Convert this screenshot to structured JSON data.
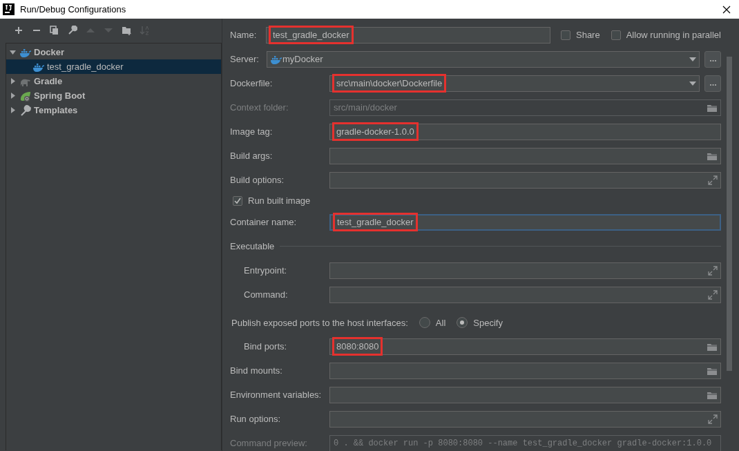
{
  "window": {
    "title": "Run/Debug Configurations"
  },
  "toolbar": [
    {
      "kind": "add",
      "disabled": false
    },
    {
      "kind": "remove",
      "disabled": false
    },
    {
      "kind": "copy",
      "disabled": false
    },
    {
      "kind": "edit",
      "disabled": false
    },
    {
      "kind": "up",
      "disabled": true
    },
    {
      "kind": "down",
      "disabled": true
    },
    {
      "kind": "folder",
      "disabled": false
    },
    {
      "kind": "sort",
      "disabled": true
    }
  ],
  "tree": [
    {
      "label": "Docker",
      "kind": "docker",
      "expanded": true,
      "selected": false,
      "children": [
        {
          "label": "test_gradle_docker",
          "kind": "docker",
          "selected": true
        }
      ]
    },
    {
      "label": "Gradle",
      "kind": "gradle",
      "expanded": false,
      "selected": false
    },
    {
      "label": "Spring Boot",
      "kind": "spring",
      "expanded": false,
      "selected": false
    },
    {
      "label": "Templates",
      "kind": "wrench",
      "expanded": false,
      "selected": false
    }
  ],
  "name": {
    "label": "Name:",
    "value": "test_gradle_docker",
    "highlighted": true
  },
  "options": [
    {
      "label": "Share",
      "checked": false
    },
    {
      "label": "Allow running in parallel",
      "checked": false
    }
  ],
  "rows": [
    {
      "kind": "combo",
      "label": "Server:",
      "value": "myDocker",
      "server_icon": true,
      "highlighted": false,
      "disabled": false
    },
    {
      "kind": "combo",
      "label": "Dockerfile:",
      "value": "src\\main\\docker\\Dockerfile",
      "highlighted": true,
      "disabled": false
    },
    {
      "kind": "browse",
      "label": "Context folder:",
      "value": "src/main/docker",
      "highlighted": false,
      "disabled": true
    },
    {
      "kind": "text",
      "label": "Image tag:",
      "value": "gradle-docker-1.0.0",
      "highlighted": true,
      "disabled": false,
      "focused": false
    },
    {
      "kind": "browse",
      "label": "Build args:",
      "disabled": false
    },
    {
      "kind": "expand",
      "label": "Build options:",
      "disabled": false
    },
    {
      "kind": "checkbox",
      "label": "Run built image",
      "checked": true
    },
    {
      "kind": "text",
      "label": "Container name:",
      "value": "test_gradle_docker",
      "highlighted": true,
      "disabled": false,
      "focused": true
    },
    {
      "kind": "section",
      "label": "Executable",
      "children": [
        {
          "kind": "expand",
          "label": "Entrypoint:",
          "disabled": false
        },
        {
          "kind": "expand",
          "label": "Command:",
          "disabled": false
        }
      ]
    },
    {
      "kind": "radio",
      "label": "Publish exposed ports to the host interfaces:",
      "choices": [
        {
          "label": "All",
          "selected": false
        },
        {
          "label": "Specify",
          "selected": true
        }
      ],
      "children": [
        {
          "kind": "browse",
          "label": "Bind ports:",
          "value": "8080:8080",
          "highlighted": true,
          "disabled": false
        }
      ]
    },
    {
      "kind": "browse",
      "label": "Bind mounts:",
      "disabled": false
    },
    {
      "kind": "browse",
      "label": "Environment variables:",
      "disabled": false
    },
    {
      "kind": "expand",
      "label": "Run options:",
      "disabled": false
    },
    {
      "kind": "preview",
      "label": "Command preview:",
      "value": "0 . && docker run -p 8080:8080 --name test_gradle_docker gradle-docker:1.0.0",
      "highlighted": false,
      "disabled": true
    }
  ]
}
